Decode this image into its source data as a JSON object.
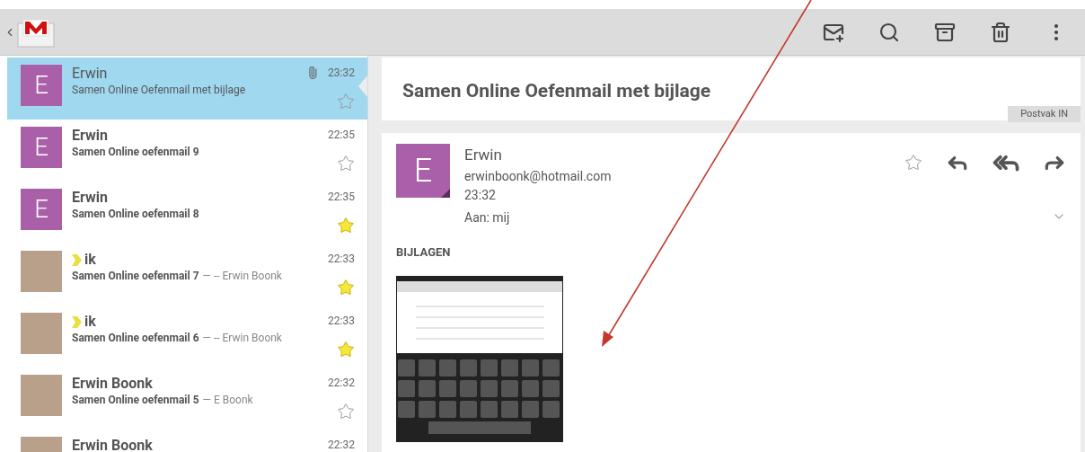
{
  "toolbar": {
    "actions": [
      {
        "kind": "compose"
      },
      {
        "kind": "search"
      },
      {
        "kind": "archive"
      },
      {
        "kind": "delete"
      },
      {
        "kind": "more"
      }
    ]
  },
  "emails": [
    {
      "selected": true,
      "unread": false,
      "important": false,
      "avatar": {
        "kind": "letter",
        "text": "E"
      },
      "sender": "Erwin",
      "subject": "Samen Online Oefenmail met bijlage",
      "time": "23:32",
      "has_attachment": true,
      "starred": false
    },
    {
      "selected": false,
      "unread": true,
      "important": false,
      "avatar": {
        "kind": "letter",
        "text": "E"
      },
      "sender": "Erwin",
      "subject": "Samen Online oefenmail 9",
      "time": "22:35",
      "has_attachment": false,
      "starred": false
    },
    {
      "selected": false,
      "unread": true,
      "important": false,
      "avatar": {
        "kind": "letter",
        "text": "E"
      },
      "sender": "Erwin",
      "subject": "Samen Online oefenmail 8",
      "time": "22:35",
      "has_attachment": false,
      "starred": true
    },
    {
      "selected": false,
      "unread": true,
      "important": true,
      "avatar": {
        "kind": "photo"
      },
      "sender": "ik",
      "subject": "Samen Online oefenmail 7",
      "snippet": "— -- Erwin Boonk",
      "time": "22:33",
      "has_attachment": false,
      "starred": true
    },
    {
      "selected": false,
      "unread": true,
      "important": true,
      "avatar": {
        "kind": "photo"
      },
      "sender": "ik",
      "subject": "Samen Online oefenmail 6",
      "snippet": "— -- Erwin Boonk",
      "time": "22:33",
      "has_attachment": false,
      "starred": true
    },
    {
      "selected": false,
      "unread": true,
      "important": false,
      "avatar": {
        "kind": "photo"
      },
      "sender": "Erwin Boonk",
      "subject": "Samen Online oefenmail 5",
      "snippet": "— E Boonk",
      "time": "22:32",
      "has_attachment": false,
      "starred": false
    },
    {
      "selected": false,
      "unread": true,
      "important": false,
      "avatar": {
        "kind": "photo"
      },
      "sender": "Erwin Boonk",
      "time": "22:32",
      "has_attachment": false
    }
  ],
  "conversation": {
    "subject": "Samen Online Oefenmail met bijlage",
    "label": "Postvak IN",
    "message": {
      "avatar": {
        "kind": "letter",
        "text": "E"
      },
      "sender": "Erwin",
      "email": "erwinboonk@hotmail.com",
      "time": "23:32",
      "recipients": "Aan: mij",
      "starred": false
    },
    "attachments_heading": "BIJLAGEN"
  }
}
